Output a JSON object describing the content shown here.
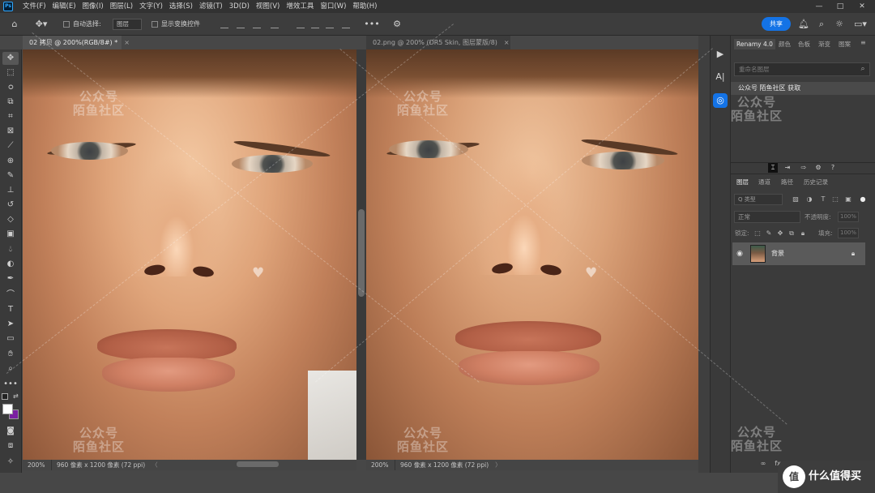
{
  "app": {
    "logo": "Ps"
  },
  "menu": [
    "文件(F)",
    "编辑(E)",
    "图像(I)",
    "图层(L)",
    "文字(Y)",
    "选择(S)",
    "滤镜(T)",
    "3D(D)",
    "视图(V)",
    "增效工具",
    "窗口(W)",
    "帮助(H)"
  ],
  "window_controls": {
    "minimize": "—",
    "maximize": "□",
    "close": "✕"
  },
  "options_bar": {
    "auto_select_label": "自动选择:",
    "auto_select_value": "图层",
    "show_transform_label": "显示变换控件",
    "more": "•••",
    "share_label": "共享"
  },
  "toolbar": {
    "tools": [
      "move-tool",
      "marquee-tool",
      "lasso-tool",
      "object-select-tool",
      "crop-tool",
      "frame-tool",
      "eyedropper-tool",
      "spot-heal-tool",
      "brush-tool",
      "stamp-tool",
      "history-brush-tool",
      "eraser-tool",
      "gradient-tool",
      "blur-tool",
      "dodge-tool",
      "pen-tool",
      "type-tool",
      "path-select-tool",
      "rectangle-tool",
      "hand-tool",
      "zoom-tool",
      "more-tools"
    ],
    "type_glyph": "T",
    "more_glyph": "•••",
    "foreground_color": "#ffffff",
    "background_color": "#7b1fa2"
  },
  "documents": [
    {
      "tab_label": "02 拷贝 @ 200%(RGB/8#) *",
      "close": "×",
      "zoom": "200%",
      "info": "960 像素 x 1200 像素 (72 ppi)",
      "arrows": "〈"
    },
    {
      "tab_label": "02.png @ 200% (DR5 Skin, 图层蒙版/8)",
      "close": "×",
      "zoom": "200%",
      "info": "960 像素 x 1200 像素 (72 ppi)",
      "arrows": "〉"
    }
  ],
  "watermark": {
    "line1": "公众号",
    "line2": "陌鱼社区"
  },
  "renamy_panel": {
    "tabs": [
      "Renamy 4.0",
      "颜色",
      "色板",
      "渐变",
      "图案"
    ],
    "search_placeholder": "重命名图层",
    "item": "公众号 陌鱼社区 获取"
  },
  "layers_panel": {
    "tabs": [
      "图层",
      "通道",
      "路径",
      "历史记录"
    ],
    "filter_label": "Q 类型",
    "blend_mode": "正常",
    "opacity_label": "不透明度:",
    "opacity_value": "100%",
    "lock_label": "锁定:",
    "fill_label": "填充:",
    "fill_value": "100%",
    "layers": [
      {
        "name": "背景",
        "visible": true,
        "locked": true
      }
    ]
  },
  "bottom_badge": {
    "logo": "值",
    "site": "什么值得买"
  }
}
